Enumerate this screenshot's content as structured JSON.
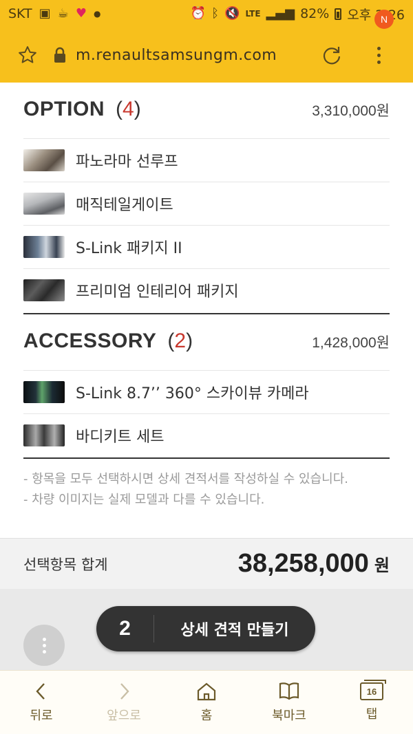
{
  "status_bar": {
    "carrier": "SKT",
    "network": "LTE",
    "battery": "82%",
    "time": "오후 2:26",
    "left_icons": [
      "image-icon",
      "coffee-icon",
      "heart-icon",
      "dot-icon"
    ],
    "right_icons": [
      "alarm-icon",
      "bluetooth-icon",
      "mute-icon",
      "signal-icon",
      "battery-icon"
    ]
  },
  "browser": {
    "url": "m.renaultsamsungm.com",
    "notification_badge": "N",
    "accent_color": "#f7c01c"
  },
  "option_section": {
    "title": "OPTION",
    "count_open": "(",
    "count": "4",
    "count_close": ")",
    "total": "3,310,000원",
    "items": [
      {
        "label": "파노라마 선루프"
      },
      {
        "label": "매직테일게이트"
      },
      {
        "label": "S-Link 패키지 II"
      },
      {
        "label": "프리미엄 인테리어 패키지"
      }
    ]
  },
  "accessory_section": {
    "title": "ACCESSORY",
    "count_open": "(",
    "count": "2",
    "count_close": ")",
    "total": "1,428,000원",
    "items": [
      {
        "label": "S-Link 8.7’’ 360° 스카이뷰 카메라"
      },
      {
        "label": "바디키트 세트"
      }
    ]
  },
  "notes": [
    "- 항목을 모두 선택하시면 상세 견적서를 작성하실 수 있습니다.",
    "- 차량 이미지는 실제 모델과 다를 수 있습니다."
  ],
  "summary": {
    "label": "선택항목 합계",
    "total": "38,258,000",
    "unit": "원"
  },
  "cta": {
    "count": "2",
    "label": "상세 견적 만들기"
  },
  "bottom_nav": {
    "back": "뒤로",
    "forward": "앞으로",
    "home": "홈",
    "bookmark": "북마크",
    "tabs": "탭",
    "tab_count": "16"
  }
}
